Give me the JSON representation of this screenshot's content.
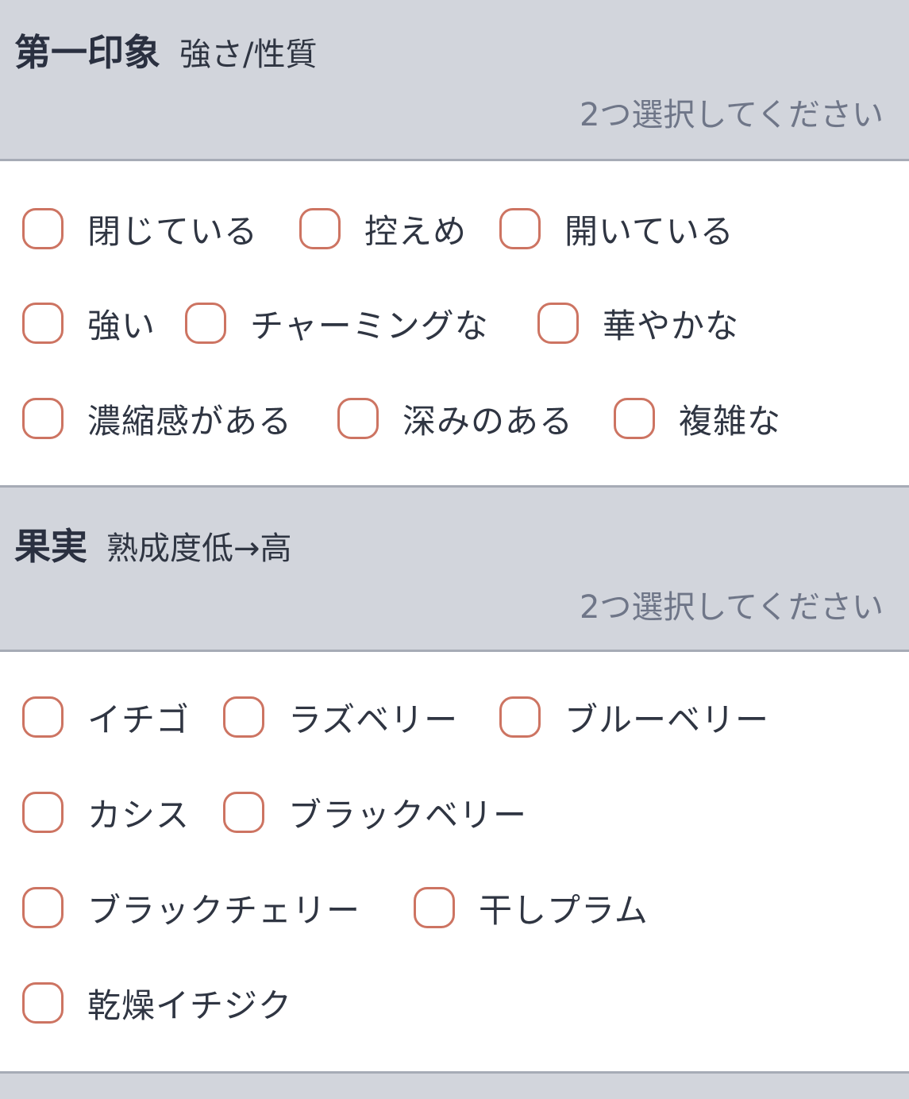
{
  "sections": [
    {
      "title": "第一印象",
      "subtitle": "強さ/性質",
      "hint": "2つ選択してください",
      "options": [
        "閉じている",
        "控えめ",
        "開いている",
        "強い",
        "チャーミングな",
        "華やかな",
        "濃縮感がある",
        "深みのある",
        "複雑な"
      ]
    },
    {
      "title": "果実",
      "subtitle": "熟成度低→高",
      "hint": "2つ選択してください",
      "options": [
        "イチゴ",
        "ラズベリー",
        "ブルーベリー",
        "カシス",
        "ブラックベリー",
        "ブラックチェリー",
        "干しプラム",
        "乾燥イチジク"
      ]
    }
  ],
  "colors": {
    "header_bg": "#d2d5dc",
    "header_border": "#a6abb6",
    "checkbox_border": "#cd7462",
    "hint_text": "#6f7688",
    "body_text": "#2f3542"
  }
}
